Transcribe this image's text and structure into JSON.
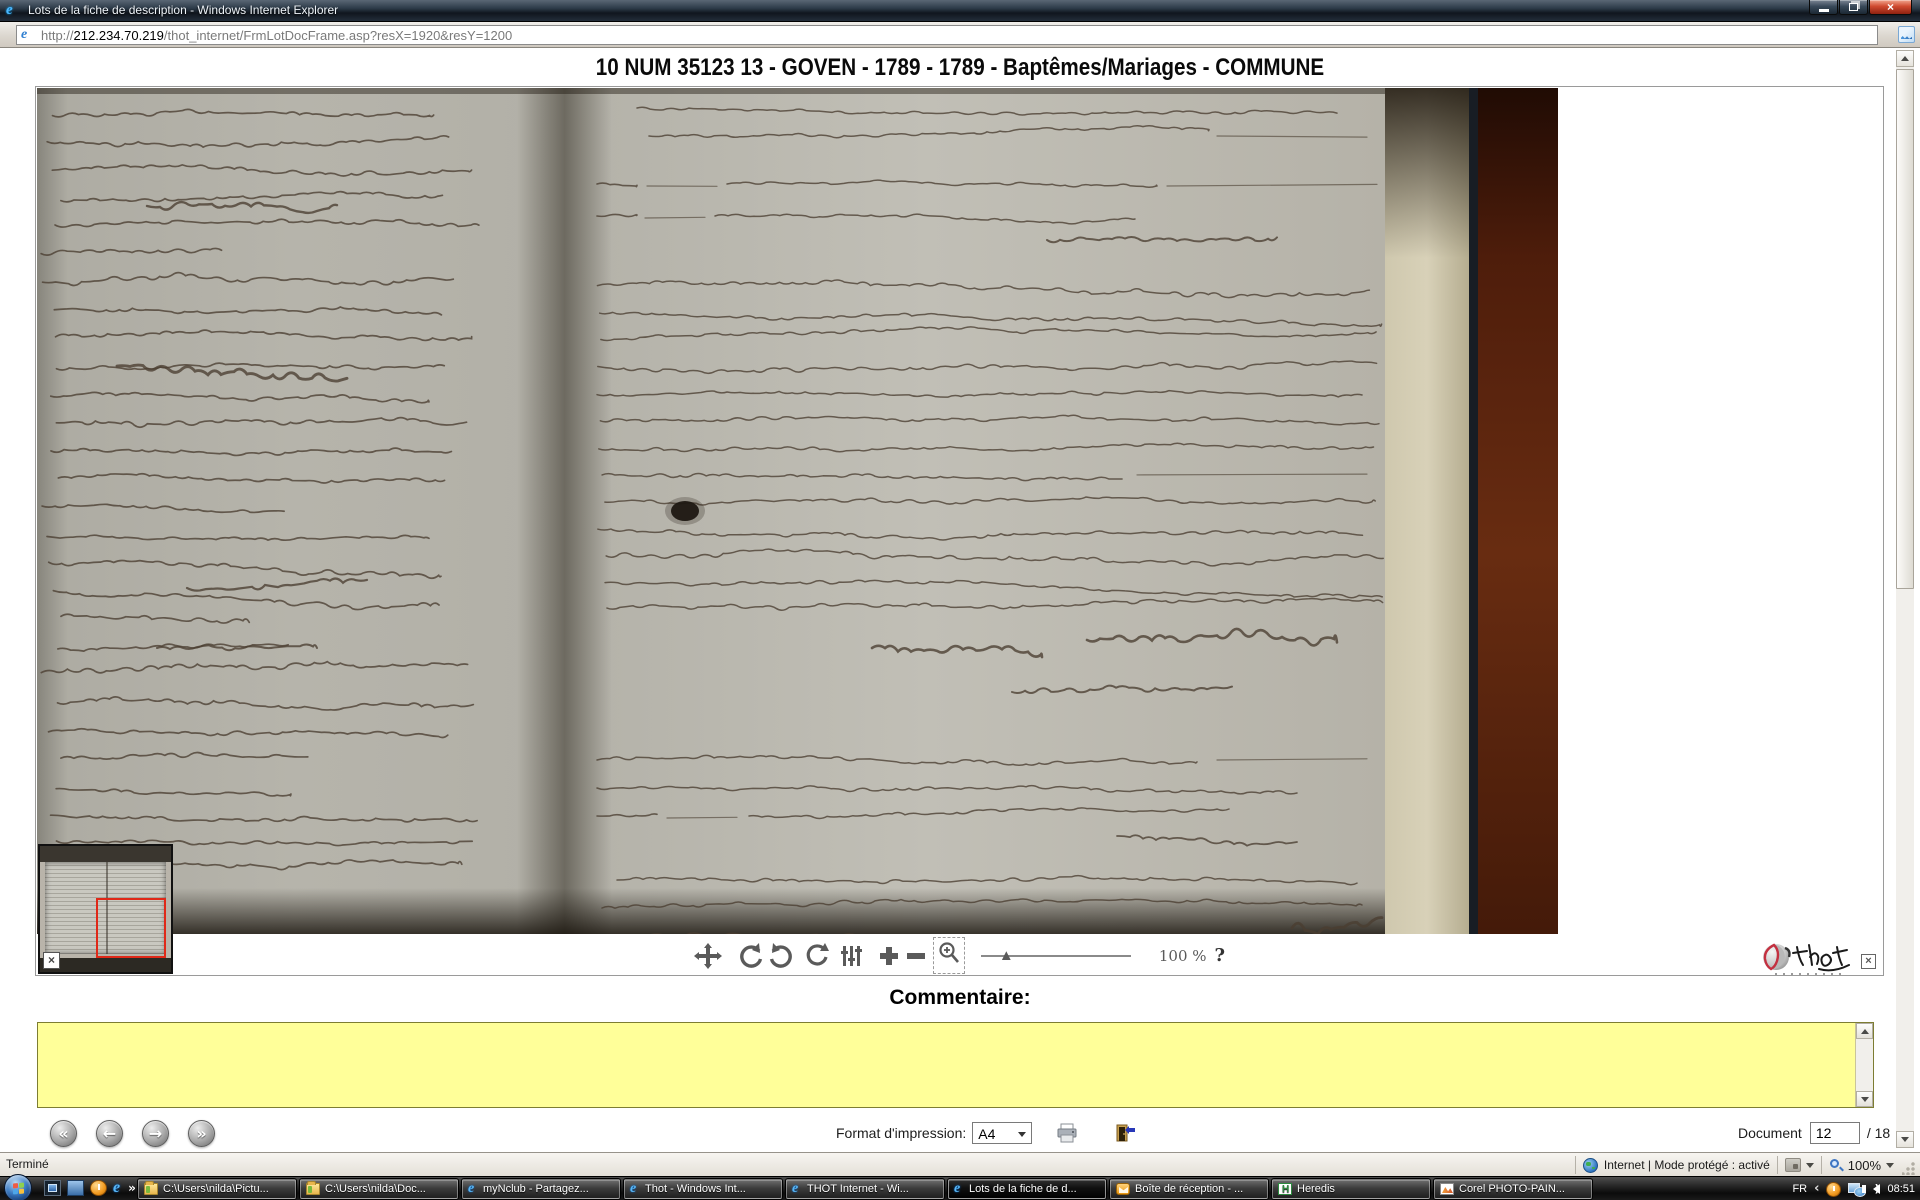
{
  "window": {
    "title": "Lots de la fiche de description - Windows Internet Explorer",
    "close_glyph": "×"
  },
  "address": {
    "scheme": "http://",
    "host": "212.234.70.219",
    "path": "/thot_internet/FrmLotDocFrame.asp?resX=1920&resY=1200",
    "ie_glyph": "e"
  },
  "document_header": {
    "title": "10 NUM 35123 13 - GOVEN - 1789 - 1789 - Baptêmes/Mariages - COMMUNE"
  },
  "viewer": {
    "zoom_value": "100 %",
    "help_glyph": "?",
    "slider_thumb": "▲",
    "logo_close": "×",
    "thumbnail_close": "×"
  },
  "comment": {
    "label": "Commentaire:",
    "value": ""
  },
  "print": {
    "label": "Format d'impression:",
    "format": "A4"
  },
  "pager": {
    "label": "Document",
    "current": "12",
    "total": "/ 18"
  },
  "nav": {
    "first": "«",
    "prev": "←",
    "next": "→",
    "last": "»"
  },
  "status": {
    "left": "Terminé",
    "zone": "Internet | Mode protégé : activé",
    "zoom": "100%"
  },
  "taskbar": {
    "overflow": "»",
    "buttons": [
      {
        "label": "C:\\Users\\nilda\\Pictu..."
      },
      {
        "label": "C:\\Users\\nilda\\Doc..."
      },
      {
        "label": "myNclub - Partagez..."
      },
      {
        "label": "Thot - Windows Int..."
      },
      {
        "label": "THOT Internet - Wi..."
      },
      {
        "label": "Lots de la fiche de d..."
      },
      {
        "label": "Boîte de réception - ..."
      },
      {
        "label": "Heredis"
      },
      {
        "label": "Corel PHOTO-PAIN..."
      }
    ],
    "tray": {
      "language": "FR",
      "chevron": "‹",
      "time": "08:51"
    }
  },
  "colors": {
    "comment_bg": "#ffff99",
    "view_rect_red": "#e02818",
    "taskbar_bg": "#1a1a1a"
  }
}
